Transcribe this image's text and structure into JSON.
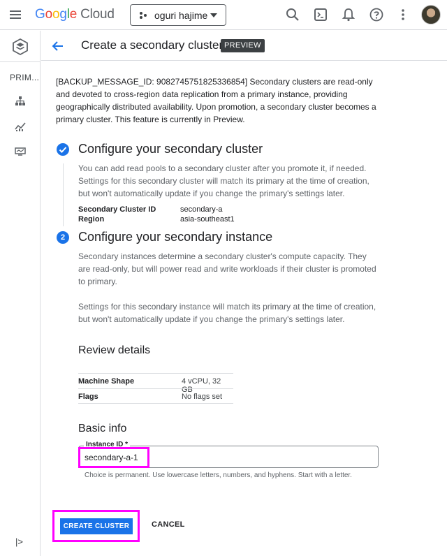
{
  "topbar": {
    "logo_parts": [
      "G",
      "o",
      "o",
      "g",
      "l",
      "e"
    ],
    "logo_cloud": "Cloud",
    "project_name": "oguri hajime",
    "icons": [
      "menu-icon",
      "project-picker-icon",
      "caret-down-icon",
      "search-icon",
      "terminal-icon",
      "bell-icon",
      "help-icon",
      "more-vert-icon",
      "avatar"
    ]
  },
  "rail": {
    "title": "PRIM...",
    "items": [
      "hierarchy-icon",
      "monitoring-icon",
      "dashboard-icon"
    ],
    "expand_label": "|>"
  },
  "header": {
    "title": "Create a secondary cluster",
    "badge": "PREVIEW"
  },
  "intro": "[BACKUP_MESSAGE_ID: 9082745751825336854] Secondary clusters are read-only and devoted to cross-region data replication from a primary instance, providing geographically distributed availability. Upon promotion, a secondary cluster becomes a primary cluster. This feature is currently in Preview.",
  "step1": {
    "title": "Configure your secondary cluster",
    "description": "You can add read pools to a secondary cluster after you promote it, if needed. Settings for this secondary cluster will match its primary at the time of creation, but won't automatically update if you change the primary's settings later.",
    "fields": [
      {
        "key": "Secondary Cluster ID",
        "value": "secondary-a"
      },
      {
        "key": "Region",
        "value": "asia-southeast1"
      }
    ]
  },
  "step2": {
    "number": "2",
    "title": "Configure your secondary instance",
    "description1": "Secondary instances determine a secondary cluster's compute capacity. They are read-only, but will power read and write workloads if their cluster is promoted to primary.",
    "description2": "Settings for this secondary instance will match its primary at the time of creation, but won't automatically update if you change the primary's settings later."
  },
  "review": {
    "title": "Review details",
    "rows": [
      {
        "key": "Machine Shape",
        "value": "4 vCPU, 32 GB"
      },
      {
        "key": "Flags",
        "value": "No flags set"
      }
    ]
  },
  "basic_info": {
    "title": "Basic info",
    "field_label": "Instance ID *",
    "field_value": "secondary-a-1",
    "hint": "Choice is permanent. Use lowercase letters, numbers, and hyphens. Start with a letter."
  },
  "actions": {
    "create_label": "CREATE CLUSTER",
    "cancel_label": "CANCEL"
  },
  "colors": {
    "accent": "#1a73e8",
    "highlight": "#ff00ff"
  }
}
